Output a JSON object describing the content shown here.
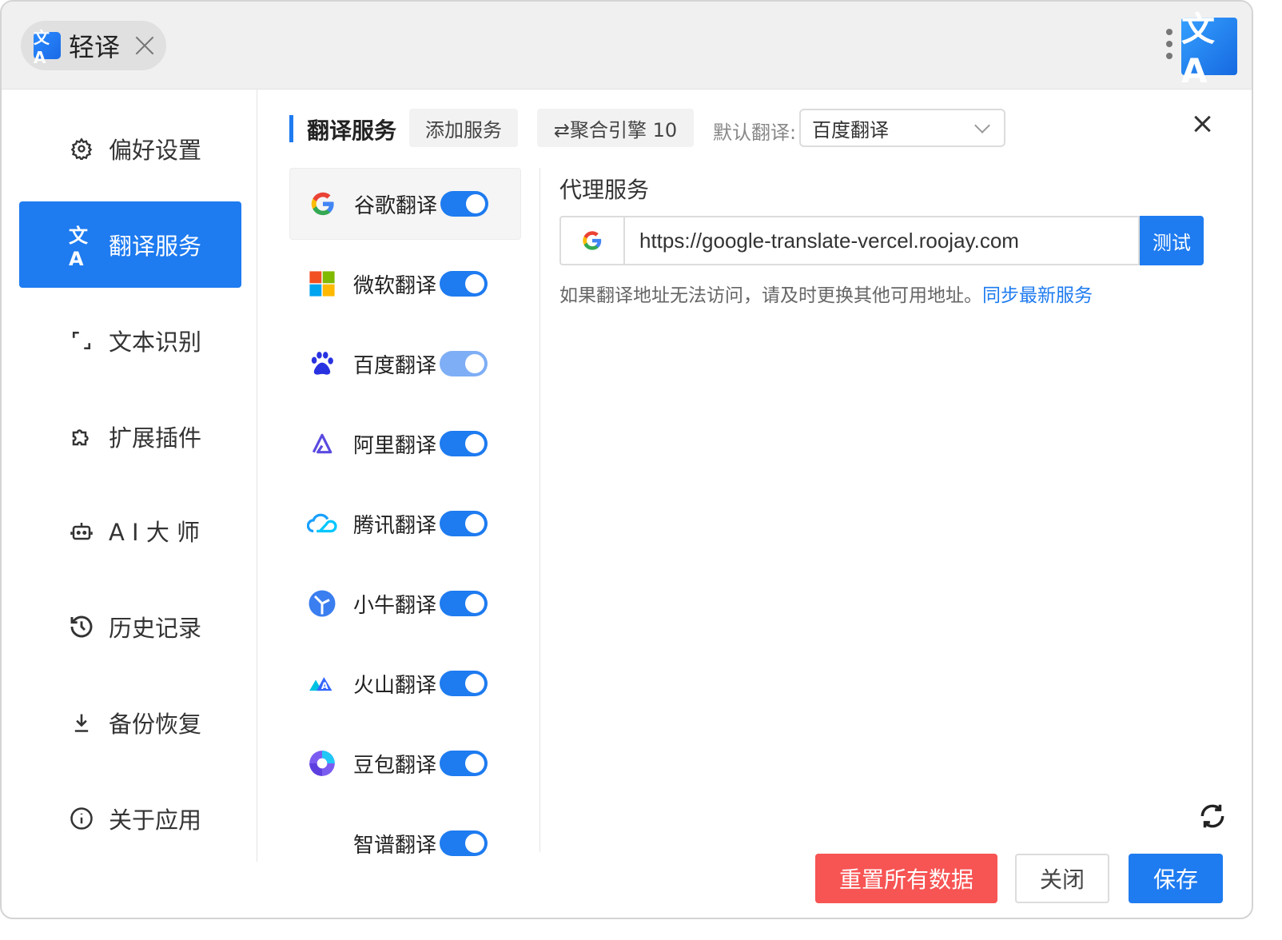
{
  "app": {
    "tab_title": "轻译",
    "logo_text": "文A"
  },
  "sidebar": {
    "items": [
      {
        "label": "偏好设置",
        "icon": "gear-icon"
      },
      {
        "label": "翻译服务",
        "icon": "translate-icon"
      },
      {
        "label": "文本识别",
        "icon": "scan-icon"
      },
      {
        "label": "扩展插件",
        "icon": "puzzle-icon"
      },
      {
        "label": "A I 大 师",
        "icon": "robot-icon"
      },
      {
        "label": "历史记录",
        "icon": "history-icon"
      },
      {
        "label": "备份恢复",
        "icon": "download-icon"
      },
      {
        "label": "关于应用",
        "icon": "info-icon"
      }
    ],
    "active_index": 1
  },
  "header": {
    "section_title": "翻译服务",
    "add_service": "添加服务",
    "aggregate_engine": "⇄聚合引擎 10",
    "default_label": "默认翻译:",
    "default_value": "百度翻译"
  },
  "services": [
    {
      "name": "谷歌翻译",
      "icon": "google-icon",
      "enabled": true
    },
    {
      "name": "微软翻译",
      "icon": "microsoft-icon",
      "enabled": true
    },
    {
      "name": "百度翻译",
      "icon": "baidu-icon",
      "enabled": true
    },
    {
      "name": "阿里翻译",
      "icon": "alibaba-icon",
      "enabled": true
    },
    {
      "name": "腾讯翻译",
      "icon": "tencent-cloud-icon",
      "enabled": true
    },
    {
      "name": "小牛翻译",
      "icon": "niutrans-icon",
      "enabled": true
    },
    {
      "name": "火山翻译",
      "icon": "volcano-icon",
      "enabled": true
    },
    {
      "name": "豆包翻译",
      "icon": "doubao-icon",
      "enabled": true
    },
    {
      "name": "智谱翻译",
      "icon": "zhipu-icon",
      "enabled": true
    }
  ],
  "proxy": {
    "title": "代理服务",
    "url": "https://google-translate-vercel.roojay.com",
    "test_button": "测试",
    "hint": "如果翻译地址无法访问，请及时更换其他可用地址。",
    "hint_link": "同步最新服务"
  },
  "footer": {
    "reset": "重置所有数据",
    "close": "关闭",
    "save": "保存"
  },
  "colors": {
    "primary": "#1e7bf0",
    "danger": "#f75454"
  }
}
